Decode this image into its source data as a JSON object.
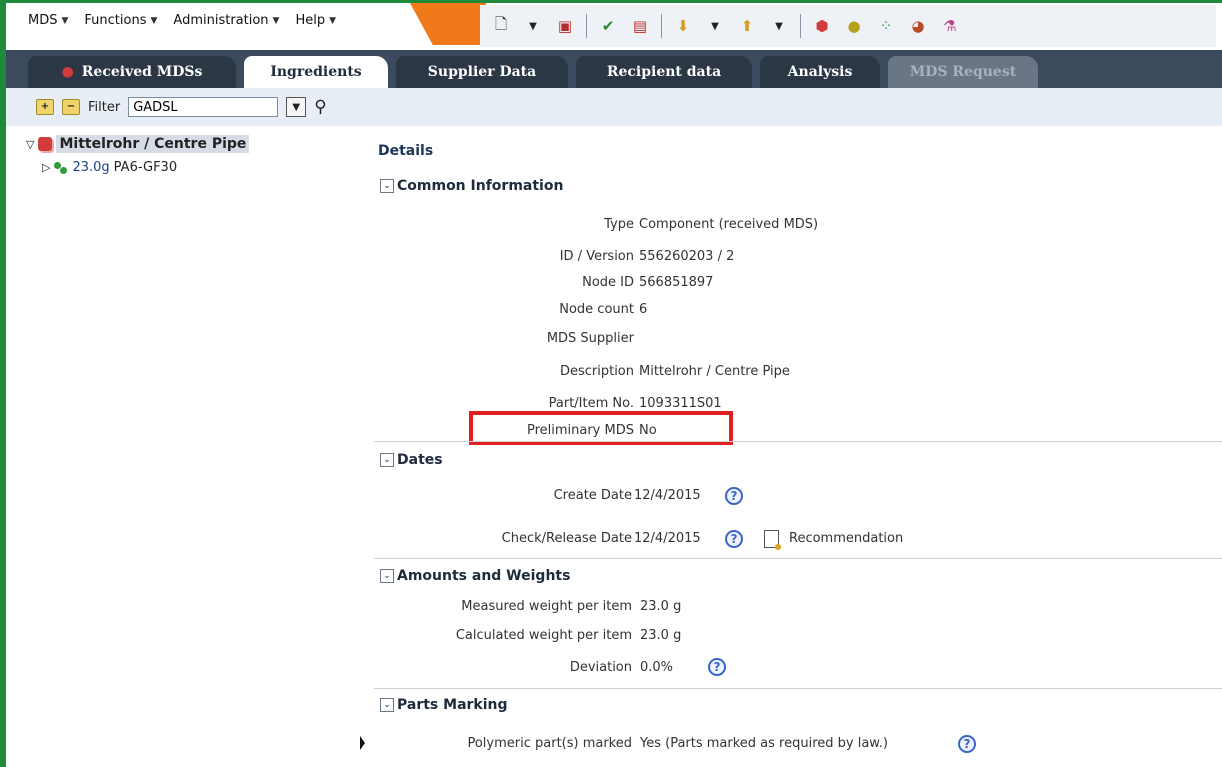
{
  "menu": {
    "items": [
      "MDS",
      "Functions",
      "Administration",
      "Help"
    ]
  },
  "toolbar": {
    "icons": [
      "new-document-icon",
      "save-icon",
      "check-document-icon",
      "pdf-icon",
      "download-icon",
      "upload-icon",
      "component-icon",
      "semi-component-icon",
      "material-icon",
      "basic-substance-icon",
      "flask-icon"
    ]
  },
  "tabs": [
    {
      "label": "Received MDSs",
      "state": "normal"
    },
    {
      "label": "Ingredients",
      "state": "active"
    },
    {
      "label": "Supplier Data",
      "state": "normal"
    },
    {
      "label": "Recipient data",
      "state": "normal"
    },
    {
      "label": "Analysis",
      "state": "normal"
    },
    {
      "label": "MDS Request",
      "state": "disabled"
    }
  ],
  "filter": {
    "label": "Filter",
    "value": "GADSL"
  },
  "tree": {
    "root": {
      "label": "Mittelrohr / Centre Pipe"
    },
    "child": {
      "weight": "23.0g",
      "label": "PA6-GF30"
    }
  },
  "details": {
    "title": "Details",
    "common": {
      "heading": "Common Information",
      "rows": [
        {
          "label": "Type",
          "value": "Component (received MDS)"
        },
        {
          "label": "ID / Version",
          "value": "556260203 / 2"
        },
        {
          "label": "Node ID",
          "value": "566851897"
        },
        {
          "label": "Node count",
          "value": "6"
        },
        {
          "label": "MDS Supplier",
          "value": ""
        },
        {
          "label": "Description",
          "value": "Mittelrohr / Centre Pipe"
        },
        {
          "label": "Part/Item No.",
          "value": "1093311S01"
        },
        {
          "label": "Preliminary MDS",
          "value": "No"
        }
      ]
    },
    "dates": {
      "heading": "Dates",
      "create_label": "Create Date",
      "create_value": "12/4/2015",
      "check_label": "Check/Release Date",
      "check_value": "12/4/2015",
      "recommendation": "Recommendation"
    },
    "amounts": {
      "heading": "Amounts and Weights",
      "measured_label": "Measured weight per item",
      "measured_value": "23.0  g",
      "calculated_label": "Calculated weight per item",
      "calculated_value": "23.0  g",
      "deviation_label": "Deviation",
      "deviation_value": "0.0%"
    },
    "marking": {
      "heading": "Parts Marking",
      "polymeric_label": "Polymeric part(s) marked",
      "polymeric_value": "Yes (Parts marked as required by law.)"
    }
  },
  "colors": {
    "frame": "#1f8a3a",
    "tabbar": "#3b4a5c",
    "highlight": "#e02020",
    "accent_orange": "#f07a1a"
  }
}
